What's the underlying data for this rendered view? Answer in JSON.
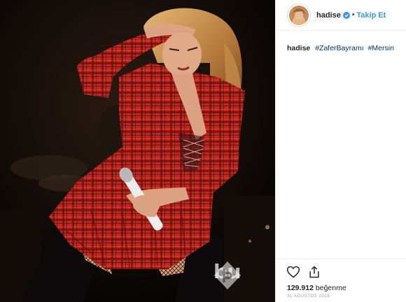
{
  "photo": {
    "alt_icon": "concert-photo",
    "watermark_text": "bu"
  },
  "header": {
    "username": "hadise",
    "separator": "•",
    "follow_label": "Takip Et"
  },
  "caption": {
    "username": "hadise",
    "hashtags": [
      "#ZaferBayramı",
      "#Mersin"
    ]
  },
  "actions": {
    "like_icon": "heart-icon",
    "share_icon": "share-icon",
    "likes_count": "129.912",
    "likes_suffix": "beğenme",
    "date": "31 AĞUSTOS 2018"
  },
  "colors": {
    "follow": "#3897f0",
    "hashtag": "#003569",
    "border": "#efefef"
  }
}
